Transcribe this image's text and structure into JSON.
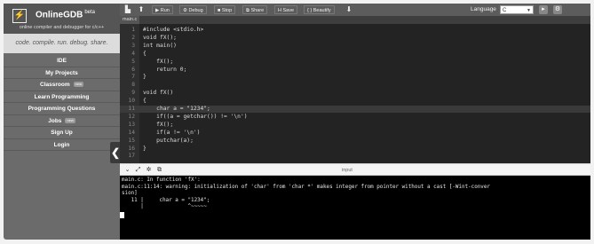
{
  "brand": {
    "logo_glyph": "⚡",
    "name": "OnlineGDB",
    "superscript": "beta",
    "subtitle": "online compiler and debugger for c/c++",
    "tagline": "code. compile. run. debug. share."
  },
  "sidebar": {
    "items": [
      {
        "label": "IDE"
      },
      {
        "label": "My Projects"
      },
      {
        "label": "Classroom",
        "badge": "new"
      },
      {
        "label": "Learn Programming"
      },
      {
        "label": "Programming Questions"
      },
      {
        "label": "Jobs",
        "badge": "new"
      },
      {
        "label": "Sign Up"
      },
      {
        "label": "Login"
      }
    ],
    "collapse_glyph": "❮"
  },
  "toolbar": {
    "run": "▶ Run",
    "debug": "⚙ Debug",
    "stop": "■ Stop",
    "share": "⧉ Share",
    "save": "H Save",
    "beautify": "{ } Beautify",
    "language_label": "Language",
    "language_value": "C",
    "icons": [
      "new-file-icon",
      "upload-icon",
      "download-icon",
      "play-circle-icon",
      "settings-icon"
    ]
  },
  "file_tabs": [
    {
      "label": "main.c"
    }
  ],
  "editor": {
    "active_line": 11,
    "lines": [
      {
        "n": "1",
        "text": "#include <stdio.h>"
      },
      {
        "n": "2",
        "text": "void fX();"
      },
      {
        "n": "3",
        "text": "int main()"
      },
      {
        "n": "4",
        "text": "{"
      },
      {
        "n": "5",
        "text": "    fX();"
      },
      {
        "n": "6",
        "text": "    return 0;"
      },
      {
        "n": "7",
        "text": "}"
      },
      {
        "n": "8",
        "text": ""
      },
      {
        "n": "9",
        "text": "void fX()"
      },
      {
        "n": "10",
        "text": "{"
      },
      {
        "n": "11",
        "text": "    char a = \"1234\";"
      },
      {
        "n": "12",
        "text": "    if((a = getchar()) != '\\n')"
      },
      {
        "n": "13",
        "text": "    fX();"
      },
      {
        "n": "14",
        "text": "    if(a != '\\n')"
      },
      {
        "n": "15",
        "text": "    putchar(a);"
      },
      {
        "n": "16",
        "text": "}"
      },
      {
        "n": "17",
        "text": ""
      }
    ]
  },
  "io_bar": {
    "input_label": "input"
  },
  "console": {
    "lines": [
      "main.c: In function 'fX':",
      "main.c:11:14: warning: initialization of 'char' from 'char *' makes integer from pointer without a cast [-Wint-conver",
      "sion]",
      "   11 |     char a = \"1234\";",
      "      |              ^~~~~~"
    ]
  }
}
